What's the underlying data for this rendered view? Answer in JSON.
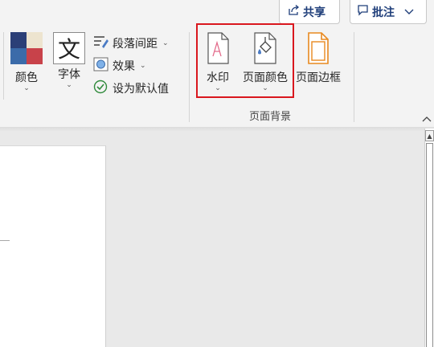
{
  "header": {
    "share_label": "共享",
    "comment_label": "批注"
  },
  "ribbon": {
    "colors_label": "颜色",
    "fonts_label": "字体",
    "fonts_glyph": "文",
    "paragraph_spacing_label": "段落间距",
    "effects_label": "效果",
    "set_default_label": "设为默认值",
    "page_background_group": {
      "label": "页面背景",
      "watermark_label": "水印",
      "page_color_label": "页面颜色",
      "page_borders_label": "页面边框"
    }
  },
  "colors": {
    "highlight": "#d9171e",
    "accent_blue": "#1f3e7a",
    "swatch_navy": "#2b3f77",
    "swatch_red": "#c8424a",
    "swatch_cream": "#ede4cf",
    "swatch_blue": "#3b6ba9",
    "border_orange": "#e8891f"
  }
}
